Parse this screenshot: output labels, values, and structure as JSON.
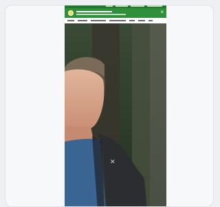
{
  "preview": {
    "topbar_links": 4,
    "nav_items": 9,
    "header": {
      "close_glyph": "×"
    },
    "icons": {
      "logo": "site-logo-icon",
      "close": "close-icon"
    },
    "colors": {
      "brand_green": "#2f8f3a",
      "topbar_green": "#1e7a2a",
      "logo_yellow": "#f1e04a",
      "card_bg": "#f7f8fa"
    }
  }
}
